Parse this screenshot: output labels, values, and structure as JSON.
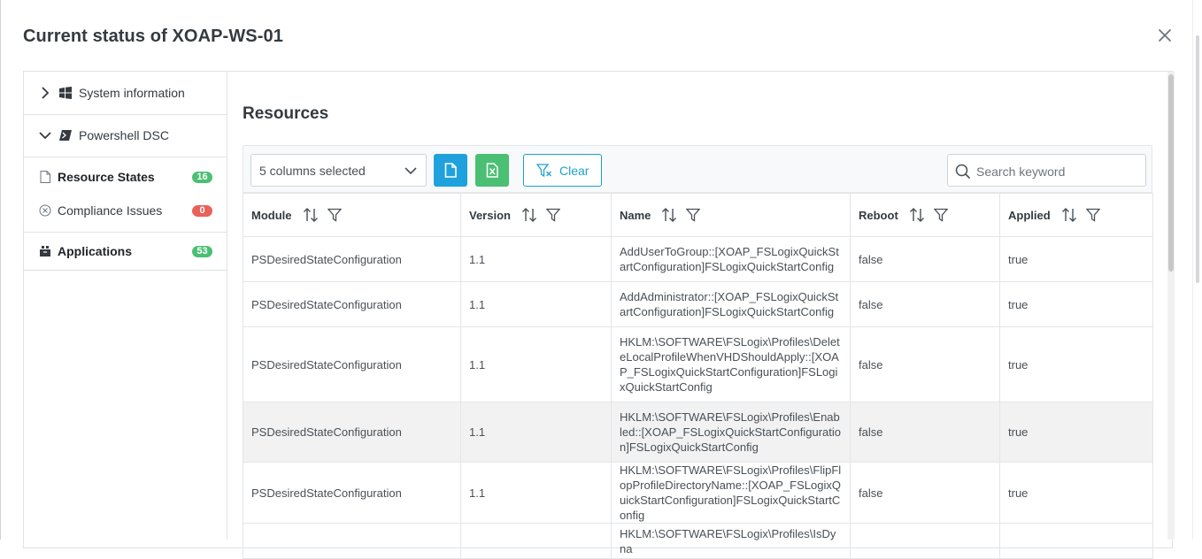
{
  "modal": {
    "title": "Current status of XOAP-WS-01",
    "close_label": "×"
  },
  "sidebar": {
    "groups": [
      {
        "label": "System information",
        "icon": "windows-icon",
        "expanded": false
      },
      {
        "label": "Powershell DSC",
        "icon": "terminal-icon",
        "expanded": true
      }
    ],
    "items": [
      {
        "label": "Resource States",
        "icon": "document-icon",
        "badge": "16",
        "badge_color": "#4bbf73",
        "active": true
      },
      {
        "label": "Compliance Issues",
        "icon": "circle-x-icon",
        "badge": "0",
        "badge_color": "#e8625a",
        "active": false
      },
      {
        "label": "Applications",
        "icon": "package-icon",
        "badge": "53",
        "badge_color": "#4bbf73",
        "active": false
      }
    ]
  },
  "content": {
    "title": "Resources",
    "toolbar": {
      "columns_select": "5 columns selected",
      "pdf_icon": "pdf-export-icon",
      "excel_icon": "excel-export-icon",
      "clear_label": "Clear",
      "search_placeholder": "Search keyword"
    },
    "table": {
      "headers": [
        "Module",
        "Version",
        "Name",
        "Reboot",
        "Applied"
      ],
      "rows": [
        [
          "PSDesiredStateConfiguration",
          "1.1",
          "AddUserToGroup::[XOAP_FSLogixQuickStartConfiguration]FSLogixQuickStartConfig",
          "false",
          "true"
        ],
        [
          "PSDesiredStateConfiguration",
          "1.1",
          "AddAdministrator::[XOAP_FSLogixQuickStartConfiguration]FSLogixQuickStartConfig",
          "false",
          "true"
        ],
        [
          "PSDesiredStateConfiguration",
          "1.1",
          "HKLM:\\SOFTWARE\\FSLogix\\Profiles\\DeleteLocalProfileWhenVHDShouldApply::[XOAP_FSLogixQuickStartConfiguration]FSLogixQuickStartConfig",
          "false",
          "true"
        ],
        [
          "PSDesiredStateConfiguration",
          "1.1",
          "HKLM:\\SOFTWARE\\FSLogix\\Profiles\\Enabled::[XOAP_FSLogixQuickStartConfiguration]FSLogixQuickStartConfig",
          "false",
          "true"
        ],
        [
          "PSDesiredStateConfiguration",
          "1.1",
          "HKLM:\\SOFTWARE\\FSLogix\\Profiles\\FlipFlopProfileDirectoryName::[XOAP_FSLogixQuickStartConfiguration]FSLogixQuickStartConfig",
          "false",
          "true"
        ],
        [
          "",
          "",
          "HKLM:\\SOFTWARE\\FSLogix\\Profiles\\IsDyna",
          "",
          ""
        ]
      ],
      "highlighted_row": 3
    }
  },
  "colors": {
    "primary": "#1ea1dc",
    "success": "#4bbf73",
    "danger": "#e8625a",
    "info_outline": "#1aa3c9"
  }
}
